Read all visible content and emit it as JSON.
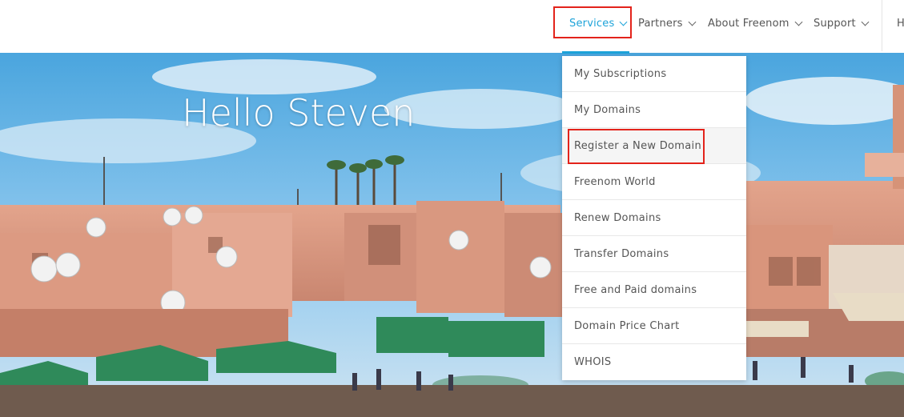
{
  "header": {
    "nav": [
      {
        "label": "Services",
        "active": true
      },
      {
        "label": "Partners"
      },
      {
        "label": "About Freenom"
      },
      {
        "label": "Support"
      }
    ],
    "nav_cut_label": "H"
  },
  "hero": {
    "greeting": "Hello Steven"
  },
  "services_menu": {
    "items": [
      "My Subscriptions",
      "My Domains",
      "Register a New Domain",
      "Freenom World",
      "Renew Domains",
      "Transfer Domains",
      "Free and Paid domains",
      "Domain Price Chart",
      "WHOIS"
    ],
    "hovered_item": "Register a New Domain"
  },
  "colors": {
    "accent": "#1da3d9",
    "annotation_red": "#e3231b"
  },
  "icons": {
    "nav_dropdown": "chevron-down-icon"
  }
}
